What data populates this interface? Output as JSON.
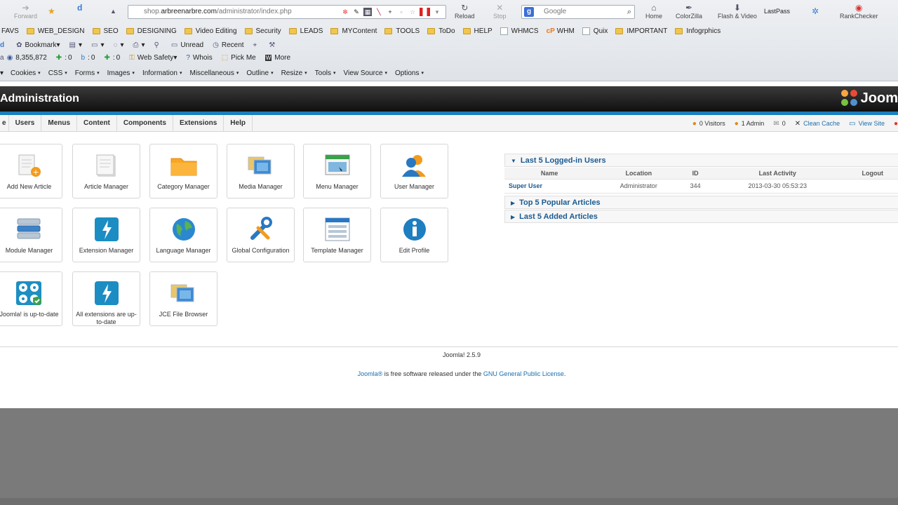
{
  "browser": {
    "nav": {
      "forward": "Forward",
      "reload": "Reload",
      "stop": "Stop",
      "home": "Home",
      "colorzilla": "ColorZilla",
      "flash_video": "Flash & Video",
      "lastpass": "LastPass",
      "rankchecker": "RankChecker"
    },
    "url": {
      "prefix": "shop.",
      "domain": "arbreenarbre.com",
      "path": "/administrator/index.php"
    },
    "search_placeholder": "Google",
    "bookmarks": [
      "FAVS",
      "WEB_DESIGN",
      "SEO",
      "DESIGNING",
      "Video Editing",
      "Security",
      "LEADS",
      "MYContent",
      "TOOLS",
      "ToDo",
      "HELP",
      "WHMCS",
      "WHM",
      "Quix",
      "IMPORTANT",
      "Infogrphics"
    ],
    "toolbar1": {
      "bookmark": "Bookmark",
      "unread": "Unread",
      "recent": "Recent"
    },
    "toolbar2": {
      "rank": "8,355,872",
      "c1": "0",
      "c2": "0",
      "c3": "0",
      "websafety": "Web Safety",
      "whois": "Whois",
      "pickme": "Pick Me",
      "more": "More"
    },
    "webdev": [
      "Cookies",
      "CSS",
      "Forms",
      "Images",
      "Information",
      "Miscellaneous",
      "Outline",
      "Resize",
      "Tools",
      "View Source",
      "Options"
    ]
  },
  "joomla": {
    "title": "Administration",
    "logo_text": "Joom",
    "menu": [
      "Users",
      "Menus",
      "Content",
      "Components",
      "Extensions",
      "Help"
    ],
    "status": {
      "visitors": "0 Visitors",
      "admins": "1 Admin",
      "messages": "0",
      "clean_cache": "Clean Cache",
      "view_site": "View Site"
    },
    "quickicons": [
      "Add New Article",
      "Article Manager",
      "Category Manager",
      "Media Manager",
      "Menu Manager",
      "User Manager",
      "Module Manager",
      "Extension Manager",
      "Language Manager",
      "Global Configuration",
      "Template Manager",
      "Edit Profile",
      "Joomla! is up-to-date",
      "All extensions are up-to-date",
      "JCE File Browser"
    ],
    "panels": {
      "logged_in": "Last 5 Logged-in Users",
      "popular": "Top 5 Popular Articles",
      "added": "Last 5 Added Articles"
    },
    "users_table": {
      "headers": [
        "Name",
        "Location",
        "ID",
        "Last Activity",
        "Logout"
      ],
      "rows": [
        {
          "name": "Super User",
          "location": "Administrator",
          "id": "344",
          "last_activity": "2013-03-30 05:53:23"
        }
      ]
    },
    "footer": {
      "version": "Joomla! 2.5.9",
      "brand": "Joomla®",
      "mid": " is free software released under the ",
      "license": "GNU General Public License",
      "end": "."
    }
  },
  "colors": {
    "accent_blue": "#1a7fbf",
    "link_blue": "#1a6fb0",
    "header_dark": "#1a1a1a"
  }
}
